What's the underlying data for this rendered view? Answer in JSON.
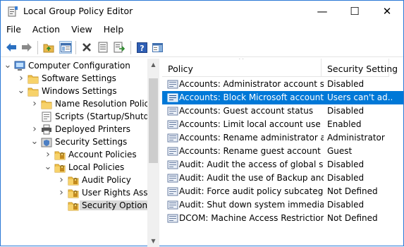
{
  "window": {
    "title": "Local Group Policy Editor",
    "minimize_glyph": "—",
    "maximize_glyph": "☐",
    "close_glyph": "✕"
  },
  "menu": [
    "File",
    "Action",
    "View",
    "Help"
  ],
  "toolbar": {
    "icons": [
      "back-icon",
      "forward-icon",
      "up-folder-icon",
      "show-hide-tree-icon",
      "delete-icon",
      "properties-icon",
      "export-list-icon",
      "help-icon",
      "show-pane-icon"
    ]
  },
  "tree": {
    "items": [
      {
        "label": "Computer Configuration",
        "expander": "expanded",
        "icon": "computer-icon"
      },
      {
        "label": "Software Settings",
        "expander": "collapsed",
        "icon": "folder-icon"
      },
      {
        "label": "Windows Settings",
        "expander": "expanded",
        "icon": "folder-icon"
      },
      {
        "label": "Name Resolution Policy",
        "expander": "collapsed",
        "icon": "folder-icon"
      },
      {
        "label": "Scripts (Startup/Shutdow",
        "expander": "none",
        "icon": "script-icon"
      },
      {
        "label": "Deployed Printers",
        "expander": "collapsed",
        "icon": "printer-icon"
      },
      {
        "label": "Security Settings",
        "expander": "expanded",
        "icon": "security-icon"
      },
      {
        "label": "Account Policies",
        "expander": "collapsed",
        "icon": "policy-folder-icon"
      },
      {
        "label": "Local Policies",
        "expander": "expanded",
        "icon": "policy-folder-icon"
      },
      {
        "label": "Audit Policy",
        "expander": "collapsed",
        "icon": "policy-folder-icon"
      },
      {
        "label": "User Rights Assign",
        "expander": "collapsed",
        "icon": "policy-folder-icon"
      },
      {
        "label": "Security Options",
        "expander": "none",
        "icon": "policy-folder-icon",
        "selected": true
      }
    ],
    "scroll_up_glyph": "▲",
    "scroll_down_glyph": "▼"
  },
  "list": {
    "columns": [
      "Policy",
      "Security Setting"
    ],
    "sort_glyph": "^",
    "rows": [
      {
        "policy": "Accounts: Administrator account sta...",
        "setting": "Disabled"
      },
      {
        "policy": "Accounts: Block Microsoft accounts",
        "setting": "Users can't ad...",
        "selected": true
      },
      {
        "policy": "Accounts: Guest account status",
        "setting": "Disabled"
      },
      {
        "policy": "Accounts: Limit local account use of...",
        "setting": "Enabled"
      },
      {
        "policy": "Accounts: Rename administrator ac...",
        "setting": "Administrator"
      },
      {
        "policy": "Accounts: Rename guest account",
        "setting": "Guest"
      },
      {
        "policy": "Audit: Audit the access of global sys...",
        "setting": "Disabled"
      },
      {
        "policy": "Audit: Audit the use of Backup and ...",
        "setting": "Disabled"
      },
      {
        "policy": "Audit: Force audit policy subcategor...",
        "setting": "Not Defined"
      },
      {
        "policy": "Audit: Shut down system immediate...",
        "setting": "Disabled"
      },
      {
        "policy": "DCOM: Machine Access Restrictions...",
        "setting": "Not Defined"
      }
    ]
  },
  "colors": {
    "selection": "#0078d7",
    "window_border": "#2b79d6",
    "tree_selected": "#d9d9d9"
  }
}
